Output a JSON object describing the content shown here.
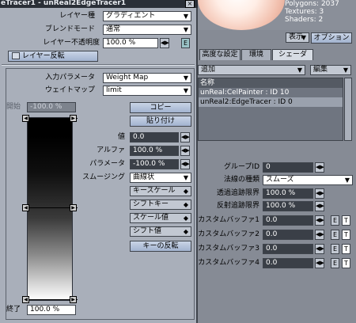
{
  "preview": {
    "polygons": "Polygons: 2037",
    "textures": "Textures: 3",
    "shaders": "Shaders: 2",
    "display_label": "表示",
    "options_label": "オプション"
  },
  "right_tabs": [
    "高度な設定",
    "環境",
    "シェーダ"
  ],
  "shader_panel": {
    "add_label": "追加",
    "edit_label": "編集",
    "list_header": "名称",
    "items": [
      "unReal:CelPainter : ID 10",
      "unReal2:EdgeTracer : ID 0"
    ],
    "group_id_label": "グループID",
    "group_id_value": "0",
    "normal_type_label": "法線の種類",
    "normal_type_value": "スムーズ",
    "transparency_limit_label": "透過追跡限界",
    "transparency_limit_value": "100.0 %",
    "reflection_limit_label": "反射追跡限界",
    "reflection_limit_value": "100.0 %",
    "custom_buffers": [
      {
        "label": "カスタムバッファ1",
        "value": "0.0"
      },
      {
        "label": "カスタムバッファ2",
        "value": "0.0"
      },
      {
        "label": "カスタムバッファ3",
        "value": "0.0"
      },
      {
        "label": "カスタムバッファ4",
        "value": "0.0"
      }
    ],
    "e_label": "E",
    "t_label": "T"
  },
  "panel": {
    "title": "eTracer1 - unReal2EdgeTracer1",
    "close": "×",
    "layer_type_label": "レイヤー種",
    "layer_type_value": "グラディエント",
    "blend_mode_label": "ブレンドモード",
    "blend_mode_value": "通常",
    "opacity_label": "レイヤー不透明度",
    "opacity_value": "100.0 %",
    "e_label": "E",
    "invert_layer_label": "レイヤー反転",
    "input_param_label": "入力パラメータ",
    "input_param_value": "Weight Map",
    "weight_map_label": "ウェイトマップ",
    "weight_map_value": "limit",
    "start_label": "開始",
    "start_value": "-100.0 %",
    "end_label": "終了",
    "end_value": "100.0 %",
    "copy_label": "コピー",
    "paste_label": "貼り付け",
    "value_label": "値",
    "value_value": "0.0",
    "alpha_label": "アルファ",
    "alpha_value": "100.0 %",
    "parameter_label": "パラメータ",
    "parameter_value": "-100.0 %",
    "smoothing_label": "スムージング",
    "smoothing_value": "曲線状",
    "key_scale_label": "キースケール",
    "shift_key_label": "シフトキー",
    "scale_value_label": "スケール値",
    "shift_value_label": "シフト値",
    "invert_keys_label": "キーの反転"
  }
}
